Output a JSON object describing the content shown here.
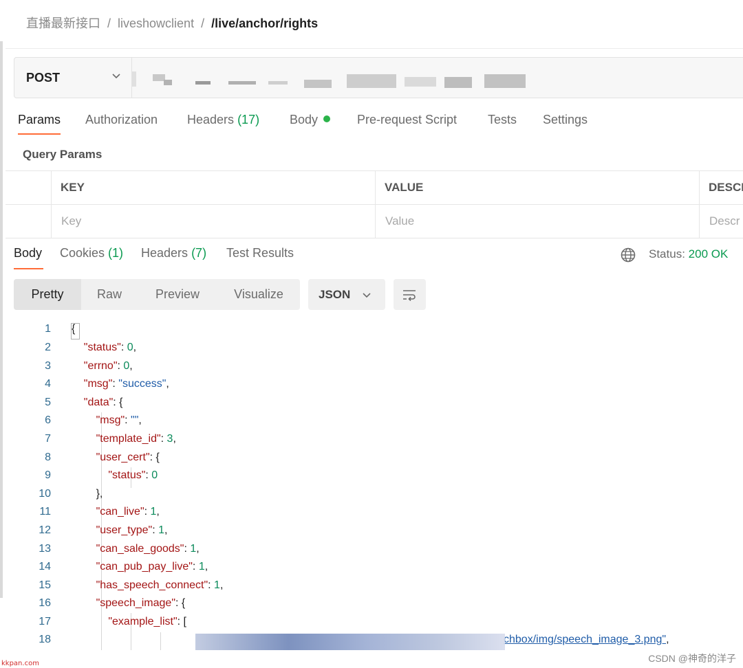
{
  "breadcrumb": {
    "collection": "直播最新接口",
    "folder": "liveshowclient",
    "current": "/live/anchor/rights",
    "separator": "/"
  },
  "request": {
    "method": "POST"
  },
  "request_tabs": [
    {
      "label": "Params",
      "active": true
    },
    {
      "label": "Authorization"
    },
    {
      "label": "Headers",
      "count": "(17)"
    },
    {
      "label": "Body",
      "indicator": "green-dot"
    },
    {
      "label": "Pre-request Script"
    },
    {
      "label": "Tests"
    },
    {
      "label": "Settings"
    }
  ],
  "query_params": {
    "title": "Query Params",
    "headers": [
      "KEY",
      "VALUE",
      "DESCI"
    ],
    "placeholders": [
      "Key",
      "Value",
      "Descr"
    ]
  },
  "response_tabs": [
    {
      "label": "Body",
      "active": true
    },
    {
      "label": "Cookies",
      "count": "(1)"
    },
    {
      "label": "Headers",
      "count": "(7)"
    },
    {
      "label": "Test Results"
    }
  ],
  "status": {
    "label": "Status:",
    "value": "200 OK",
    "icon": "globe-icon"
  },
  "view_modes": [
    "Pretty",
    "Raw",
    "Preview",
    "Visualize"
  ],
  "format": "JSON",
  "code_lines": [
    {
      "n": "1"
    },
    {
      "n": "2"
    },
    {
      "n": "3"
    },
    {
      "n": "4"
    },
    {
      "n": "5"
    },
    {
      "n": "6"
    },
    {
      "n": "7"
    },
    {
      "n": "8"
    },
    {
      "n": "9"
    },
    {
      "n": "10"
    },
    {
      "n": "11"
    },
    {
      "n": "12"
    },
    {
      "n": "13"
    },
    {
      "n": "14"
    },
    {
      "n": "15"
    },
    {
      "n": "16"
    },
    {
      "n": "17"
    },
    {
      "n": "18"
    }
  ],
  "code": {
    "l1_open": "{",
    "l2_key": "\"status\"",
    "l2_val": "0",
    "l3_key": "\"errno\"",
    "l3_val": "0",
    "l4_key": "\"msg\"",
    "l4_val": "\"success\"",
    "l5_key": "\"data\"",
    "l5_open": "{",
    "l6_key": "\"msg\"",
    "l6_val": "\"\"",
    "l7_key": "\"template_id\"",
    "l7_val": "3",
    "l8_key": "\"user_cert\"",
    "l8_open": "{",
    "l9_key": "\"status\"",
    "l9_val": "0",
    "l10_close": "},",
    "l11_key": "\"can_live\"",
    "l11_val": "1",
    "l12_key": "\"user_type\"",
    "l12_val": "1",
    "l13_key": "\"can_sale_goods\"",
    "l13_val": "1",
    "l14_key": "\"can_pub_pay_live\"",
    "l14_val": "1",
    "l15_key": "\"has_speech_connect\"",
    "l15_val": "1",
    "l16_key": "\"speech_image\"",
    "l16_open": "{",
    "l17_key": "\"example_list\"",
    "l17_open": "[",
    "l18_tail": "chbox/img/speech_image_3.png\""
  },
  "watermarks": {
    "left": "kkpan.com",
    "right": "CSDN @神奇的洋子"
  }
}
